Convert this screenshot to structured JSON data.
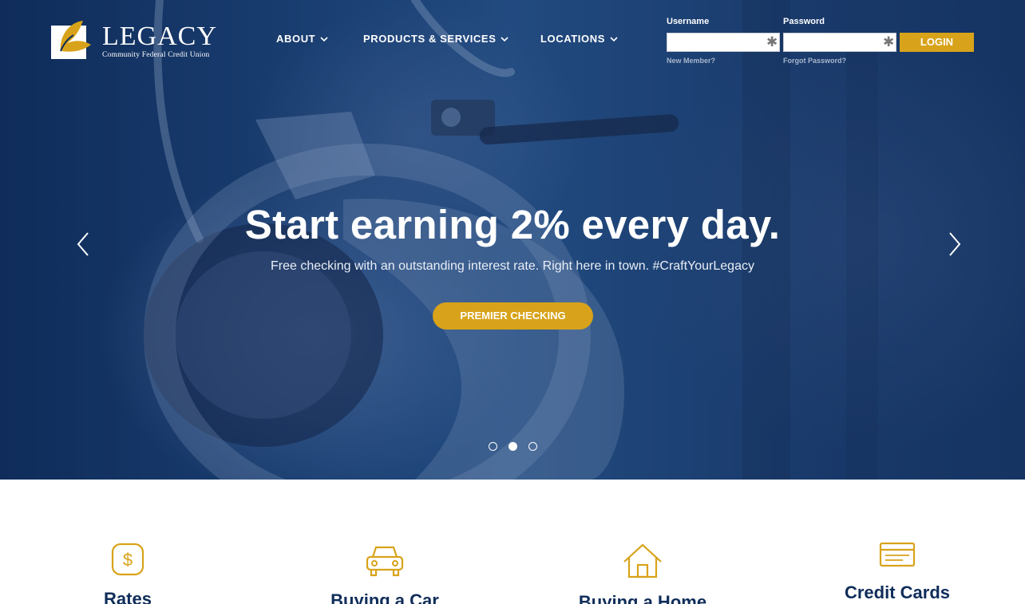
{
  "brand": {
    "name": "LEGACY",
    "tagline": "Community Federal Credit Union",
    "accent": "#d8a31a",
    "navy": "#0f2d5a"
  },
  "nav": {
    "items": [
      {
        "label": "ABOUT",
        "icon": "chevron-down-icon"
      },
      {
        "label": "PRODUCTS & SERVICES",
        "icon": "chevron-down-icon"
      },
      {
        "label": "LOCATIONS",
        "icon": "chevron-down-icon"
      }
    ]
  },
  "login": {
    "username_label": "Username",
    "username_value": "",
    "password_label": "Password",
    "password_value": "",
    "required_marker": "✱",
    "button_label": "LOGIN",
    "new_member": "New Member?",
    "forgot_password": "Forgot Password?"
  },
  "hero": {
    "headline": "Start earning 2% every day.",
    "subline": "Free checking with an outstanding interest rate. Right here in town. #CraftYourLegacy",
    "cta_label": "PREMIER CHECKING",
    "prev_icon": "chevron-left-icon",
    "next_icon": "chevron-right-icon",
    "slide_count": 3,
    "active_slide": 2
  },
  "features": [
    {
      "label": "Rates",
      "icon": "dollar-icon"
    },
    {
      "label": "Buying a Car",
      "icon": "car-icon"
    },
    {
      "label": "Buying a Home",
      "icon": "house-icon"
    },
    {
      "label": "Credit Cards",
      "icon": "credit-card-icon"
    }
  ]
}
